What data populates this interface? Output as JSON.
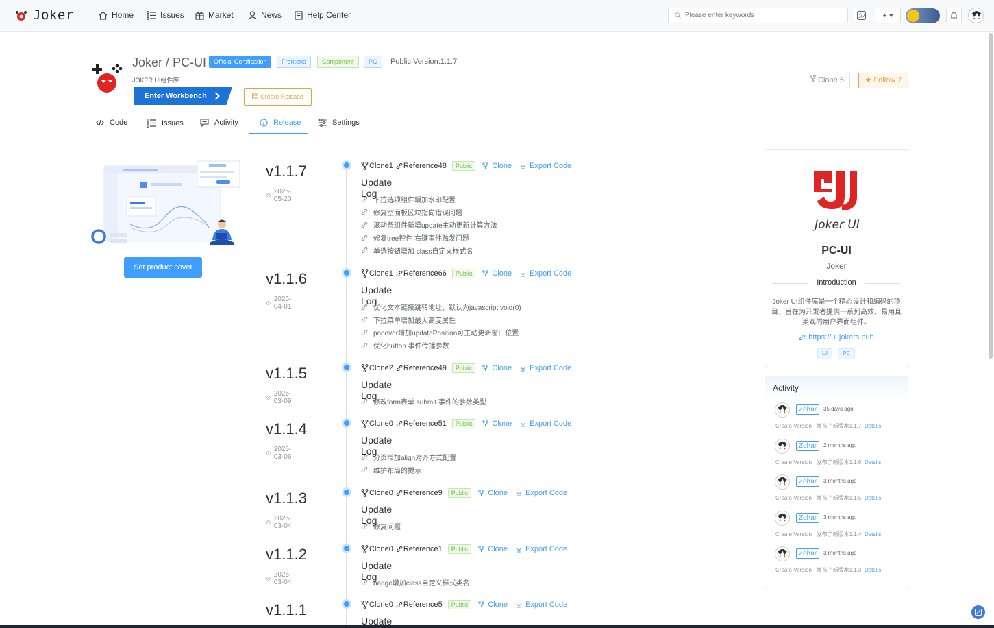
{
  "nav": {
    "brand": "Joker",
    "items": [
      {
        "label": "Home",
        "icon": "home-icon"
      },
      {
        "label": "Issues",
        "icon": "list-icon"
      },
      {
        "label": "Market",
        "icon": "gift-icon"
      },
      {
        "label": "News",
        "icon": "user-icon"
      },
      {
        "label": "Help Center",
        "icon": "book-icon"
      }
    ],
    "search_placeholder": "Please enter keywords",
    "plus_label": "+ ▾"
  },
  "project": {
    "owner": "Joker",
    "separator": "/",
    "name": "PC-UI",
    "subtitle": "JOKER UI组件库",
    "tags": [
      {
        "label": "Official Certification",
        "color": "#409eff"
      },
      {
        "label": "Frontend",
        "color": "#409eff"
      },
      {
        "label": "Component",
        "color": "#67c23a"
      },
      {
        "label": "PC",
        "color": "#409eff"
      }
    ],
    "public_version": "Public Version:1.1.7",
    "enter_workbench": "Enter Workbench",
    "create_release": "Create Release",
    "clone_label": "Clone 5",
    "follow_label": "Follow 7"
  },
  "tabs": [
    {
      "label": "Code",
      "icon": "code-icon"
    },
    {
      "label": "Issues",
      "icon": "list-icon"
    },
    {
      "label": "Activity",
      "icon": "comment-icon"
    },
    {
      "label": "Release",
      "icon": "info-icon",
      "active": true
    },
    {
      "label": "Settings",
      "icon": "sliders-icon"
    }
  ],
  "cover": {
    "button_label": "Set product cover"
  },
  "releases": [
    {
      "version": "v1.1.7",
      "date": "2025-05-20",
      "clone": "Clone1",
      "reference": "Reference48",
      "visibility": "Public",
      "clone_link": "Clone",
      "export_link": "Export Code",
      "log_title": "Update Log",
      "items": [
        "下拉选项组件增加水印配置",
        "修复空面板区块指向错误问题",
        "滚动条组件新增update主动更新计算方法",
        "修复tree控件 右键事件触发问题",
        "单选按钮增加 class自定义样式名"
      ]
    },
    {
      "version": "v1.1.6",
      "date": "2025-04-01",
      "clone": "Clone1",
      "reference": "Reference66",
      "visibility": "Public",
      "clone_link": "Clone",
      "export_link": "Export Code",
      "log_title": "Update Log",
      "items": [
        "优化文本链接跳转地址，默认为javascript:void(0)",
        "下拉菜单增加最大高度属性",
        "popover增加updatePosition可主动更新窗口位置",
        "优化button 事件传播参数"
      ]
    },
    {
      "version": "v1.1.5",
      "date": "2025-03-09",
      "clone": "Clone2",
      "reference": "Reference49",
      "visibility": "Public",
      "clone_link": "Clone",
      "export_link": "Export Code",
      "log_title": "Update Log",
      "items": [
        "修改form表单 submit 事件的参数类型"
      ]
    },
    {
      "version": "v1.1.4",
      "date": "2025-03-06",
      "clone": "Clone0",
      "reference": "Reference51",
      "visibility": "Public",
      "clone_link": "Clone",
      "export_link": "Export Code",
      "log_title": "Update Log",
      "items": [
        "分页增加align对齐方式配置",
        "维护布局的提示"
      ]
    },
    {
      "version": "v1.1.3",
      "date": "2025-03-04",
      "clone": "Clone0",
      "reference": "Reference9",
      "visibility": "Public",
      "clone_link": "Clone",
      "export_link": "Export Code",
      "log_title": "Update Log",
      "items": [
        "修复问题"
      ]
    },
    {
      "version": "v1.1.2",
      "date": "2025-03-04",
      "clone": "Clone0",
      "reference": "Reference1",
      "visibility": "Public",
      "clone_link": "Clone",
      "export_link": "Export Code",
      "log_title": "Update Log",
      "items": [
        "badge增加class自定义样式类名"
      ]
    },
    {
      "version": "v1.1.1",
      "date": "",
      "clone": "Clone0",
      "reference": "Reference5",
      "visibility": "Public",
      "clone_link": "Clone",
      "export_link": "Export Code",
      "log_title": "Update Log",
      "items": []
    }
  ],
  "card": {
    "logo_caption": "Joker UI",
    "name": "PC-UI",
    "owner": "Joker",
    "intro_label": "Introduction",
    "description": "Joker UI组件库是一个精心设计和编码的项目，旨在为开发者提供一系列高效、易用且美观的用户界面组件。",
    "url": "https://ui.jokers.pub",
    "tags": [
      "UI",
      "PC"
    ],
    "brand_color": "#e02424"
  },
  "activity": {
    "title": "Activity",
    "entries": [
      {
        "user": "Zohar",
        "ago": "35 days ago",
        "action": "Create Version",
        "text": "发布了新版本1.1.7",
        "details": "Details"
      },
      {
        "user": "Zohar",
        "ago": "2 months ago",
        "action": "Create Version",
        "text": "发布了新版本1.1.6",
        "details": "Details"
      },
      {
        "user": "Zohar",
        "ago": "3 months ago",
        "action": "Create Version",
        "text": "发布了新版本1.1.5",
        "details": "Details"
      },
      {
        "user": "Zohar",
        "ago": "3 months ago",
        "action": "Create Version",
        "text": "发布了新版本1.1.4",
        "details": "Details"
      },
      {
        "user": "Zohar",
        "ago": "3 months ago",
        "action": "Create Version",
        "text": "发布了新版本1.1.3",
        "details": "Details"
      }
    ]
  }
}
